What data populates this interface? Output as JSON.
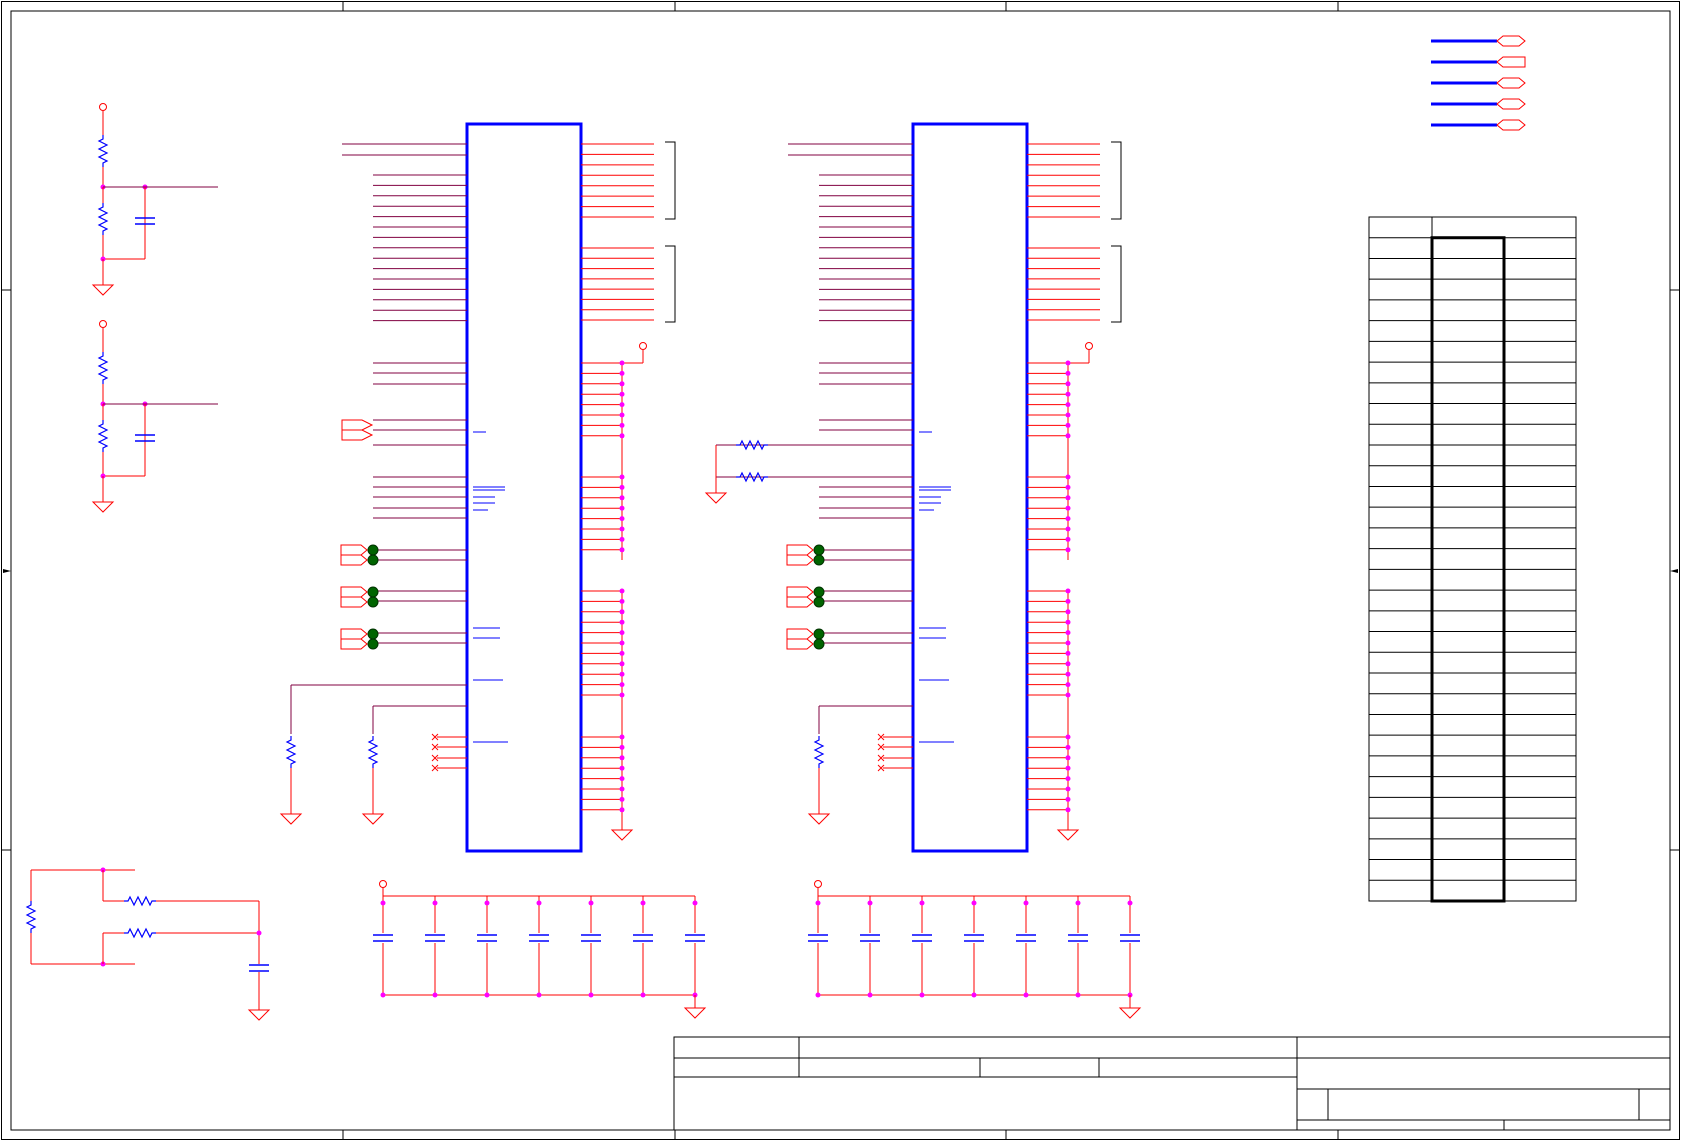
{
  "schematic": {
    "colors": {
      "frame": "#000000",
      "wire": "#ff0000",
      "net": "#800040",
      "component": "#0000ff",
      "junction": "#ff00ff",
      "test_point": "#006400"
    },
    "net_flag_count": 5,
    "ic_count": 2,
    "table_row_count": 33
  }
}
